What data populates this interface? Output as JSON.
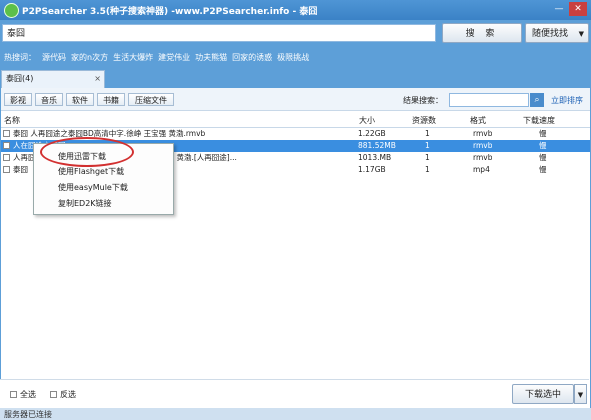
{
  "window": {
    "title": "P2PSearcher 3.5(种子搜索神器) -www.P2PSearcher.info - 泰囧",
    "minimize": "—",
    "close": "✕"
  },
  "search": {
    "query": "泰囧",
    "button": "搜 索",
    "dropdown": "随便找找"
  },
  "hot": {
    "label": "热搜词：",
    "items": [
      "源代码",
      "家的n次方",
      "生活大爆炸",
      "建党伟业",
      "功夫熊猫",
      "回家的诱惑",
      "极限挑战"
    ]
  },
  "tab": {
    "label": "泰囧(4)",
    "close": "×"
  },
  "filters": [
    "影视",
    "音乐",
    "软件",
    "书籍",
    "压缩文件"
  ],
  "result_search": {
    "label": "结果搜索：",
    "sort": "立即排序"
  },
  "columns": {
    "name": "名称",
    "size": "大小",
    "sources": "资源数",
    "format": "格式",
    "speed": "下载速度"
  },
  "rows": [
    {
      "name": "泰囧 人再囧途之泰囧BD高清中字.徐峥 王宝强 黄渤.rmvb",
      "size": "1.22GB",
      "sources": "1",
      "format": "rmvb",
      "speed": "慢"
    },
    {
      "name": "人在囧途之泰囧",
      "size": "881.52MB",
      "sources": "1",
      "format": "rmvb",
      "speed": "慢"
    },
    {
      "name": "人再囧途之泰囧 DVD 国语中英双字.徐峥 王宝强 黄渤.[人再囧途]...",
      "size": "1013.MB",
      "sources": "1",
      "format": "rmvb",
      "speed": "慢"
    },
    {
      "name": "泰囧",
      "size": "1.17GB",
      "sources": "1",
      "format": "mp4",
      "speed": "慢"
    }
  ],
  "context_menu": [
    "使用迅雷下载",
    "使用Flashget下载",
    "使用easyMule下载",
    "复制ED2K链接"
  ],
  "bottom": {
    "select_all": "全选",
    "invert": "反选",
    "download": "下载选中"
  },
  "status": "服务器已连接"
}
